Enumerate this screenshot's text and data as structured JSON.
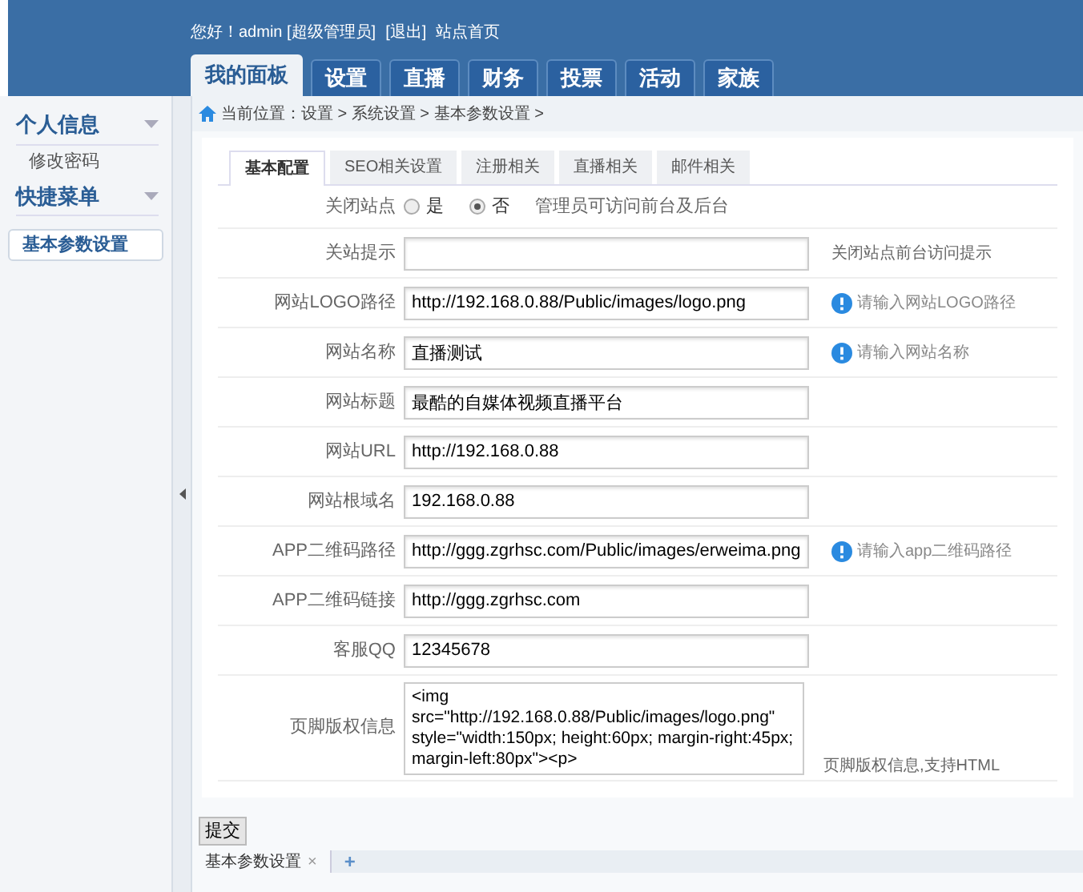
{
  "header": {
    "greeting": "您好！admin [超级管理员]",
    "links": [
      "[退出]",
      "站点首页"
    ]
  },
  "nav_tabs": [
    {
      "label": "我的面板",
      "selected": true
    },
    {
      "label": "设置",
      "selected": false
    },
    {
      "label": "直播",
      "selected": false
    },
    {
      "label": "财务",
      "selected": false
    },
    {
      "label": "投票",
      "selected": false
    },
    {
      "label": "活动",
      "selected": false
    },
    {
      "label": "家族",
      "selected": false
    }
  ],
  "sidebar": {
    "groups": [
      {
        "title": "个人信息",
        "items": [
          {
            "label": "修改密码",
            "selected": false
          }
        ]
      },
      {
        "title": "快捷菜单",
        "items": [
          {
            "label": "基本参数设置",
            "selected": true
          }
        ]
      }
    ]
  },
  "breadcrumb": "当前位置：设置 > 系统设置 > 基本参数设置 >",
  "tabs": [
    {
      "label": "基本配置",
      "selected": true
    },
    {
      "label": "SEO相关设置",
      "selected": false
    },
    {
      "label": "注册相关",
      "selected": false
    },
    {
      "label": "直播相关",
      "selected": false
    },
    {
      "label": "邮件相关",
      "selected": false
    }
  ],
  "form": {
    "rows": [
      {
        "kind": "radio",
        "label": "关闭站点",
        "options": [
          {
            "label": "是",
            "selected": false
          },
          {
            "label": "否",
            "selected": true
          }
        ],
        "note": "管理员可访问前台及后台"
      },
      {
        "kind": "input",
        "label": "关站提示",
        "note": "关闭站点前台访问提示"
      },
      {
        "kind": "input",
        "label": "网站LOGO路径",
        "value": "http://192.168.0.88/Public/images/logo.png",
        "hint": "请输入网站LOGO路径"
      },
      {
        "kind": "input",
        "label": "网站名称",
        "value": "直播测试",
        "hint": "请输入网站名称"
      },
      {
        "kind": "input",
        "label": "网站标题",
        "value": "最酷的自媒体视频直播平台"
      },
      {
        "kind": "input",
        "label": "网站URL",
        "value": "http://192.168.0.88"
      },
      {
        "kind": "input",
        "label": "网站根域名",
        "value": "192.168.0.88"
      },
      {
        "kind": "input",
        "label": "APP二维码路径",
        "value": "http://ggg.zgrhsc.com/Public/images/erweima.png",
        "hint": "请输入app二维码路径"
      },
      {
        "kind": "input",
        "label": "APP二维码链接",
        "value": "http://ggg.zgrhsc.com"
      },
      {
        "kind": "input",
        "label": "客服QQ",
        "value": "12345678"
      },
      {
        "kind": "textarea",
        "label": "页脚版权信息",
        "value": "<img src=\"http://192.168.0.88/Public/images/logo.png\" style=\"width:150px; height:60px; margin-right:45px; margin-left:80px\"><p>",
        "note": "页脚版权信息,支持HTML"
      }
    ]
  },
  "submit": "提交",
  "bottom_tabs": [
    {
      "label": "基本参数设置",
      "close": "×",
      "selected": true
    }
  ],
  "add_tab": "+"
}
